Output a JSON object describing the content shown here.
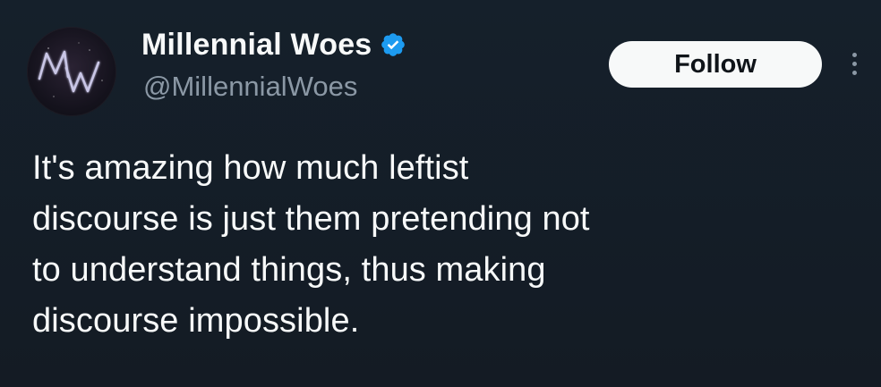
{
  "author": {
    "display_name": "Millennial Woes",
    "handle": "@MillennialWoes",
    "avatar_text": "MW",
    "verified": true
  },
  "actions": {
    "follow_label": "Follow",
    "more_icon": "more-vertical-icon"
  },
  "tweet": {
    "text": "It's amazing how much leftist\ndiscourse is just them pretending not\nto understand things, thus making\ndiscourse impossible."
  },
  "colors": {
    "background": "#15202b",
    "text_primary": "#f7f9f9",
    "text_secondary": "#8b98a5",
    "verified_badge": "#1d9bf0",
    "follow_button_bg": "#f7f9f9"
  }
}
